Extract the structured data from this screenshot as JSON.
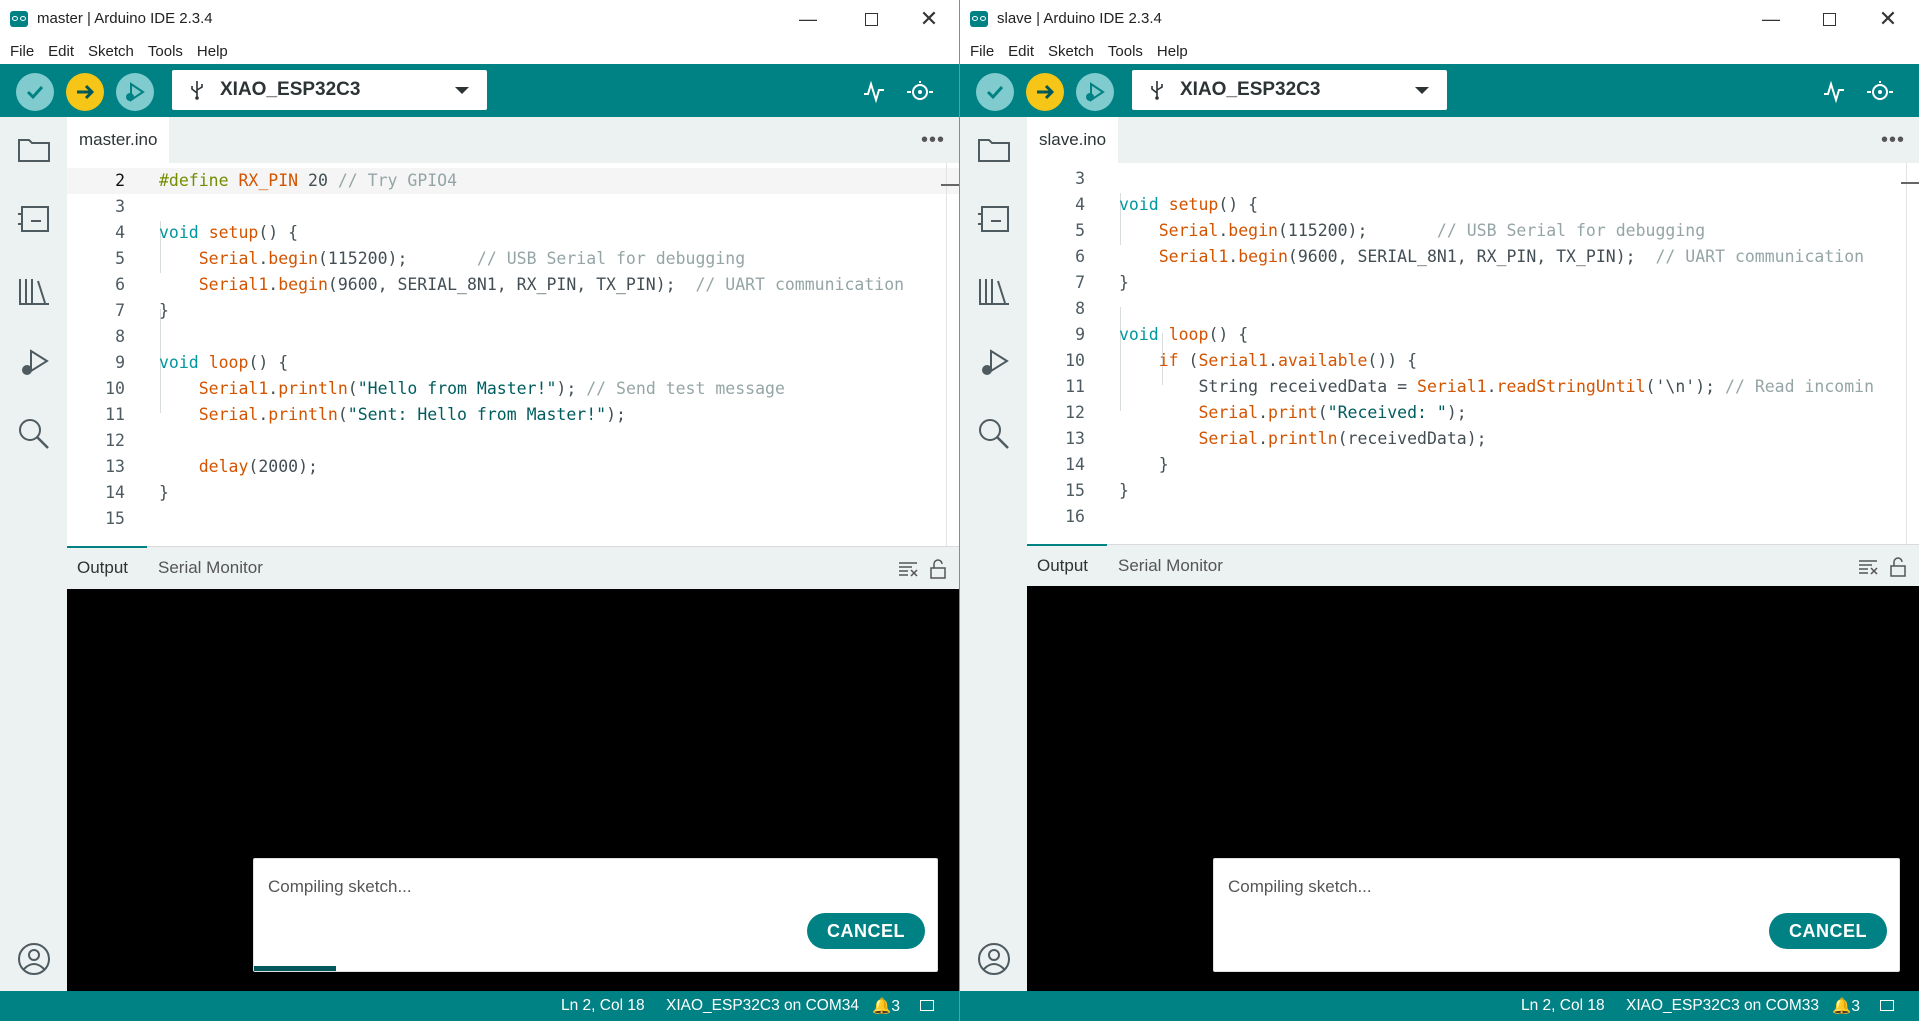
{
  "colors": {
    "teal": "#008184",
    "verify_yellow": "#f39c12",
    "sidebar_bg": "#ecf1f1",
    "output_bg": "#000000"
  },
  "windows": [
    {
      "title": "master | Arduino IDE 2.3.4",
      "menu": [
        "File",
        "Edit",
        "Sketch",
        "Tools",
        "Help"
      ],
      "board": "XIAO_ESP32C3",
      "tab": "master.ino",
      "line_numbers": [
        "2",
        "3",
        "4",
        "5",
        "6",
        "7",
        "8",
        "9",
        "10",
        "11",
        "12",
        "13",
        "14",
        "15"
      ],
      "panel_tabs": [
        "Output",
        "Serial Monitor"
      ],
      "notification": {
        "message": "Compiling sketch...",
        "cancel": "CANCEL",
        "progress_fraction": 0.12
      },
      "status": {
        "position": "Ln 2, Col 18",
        "board_port": "XIAO_ESP32C3 on COM34",
        "notifications": "3"
      }
    },
    {
      "title": "slave | Arduino IDE 2.3.4",
      "menu": [
        "File",
        "Edit",
        "Sketch",
        "Tools",
        "Help"
      ],
      "board": "XIAO_ESP32C3",
      "tab": "slave.ino",
      "line_numbers": [
        "3",
        "4",
        "5",
        "6",
        "7",
        "8",
        "9",
        "10",
        "11",
        "12",
        "13",
        "14",
        "15",
        "16"
      ],
      "panel_tabs": [
        "Output",
        "Serial Monitor"
      ],
      "notification": {
        "message": "Compiling sketch...",
        "cancel": "CANCEL",
        "progress_fraction": 0
      },
      "status": {
        "position": "Ln 2, Col 18",
        "board_port": "XIAO_ESP32C3 on COM33",
        "notifications": "3"
      }
    }
  ],
  "code": {
    "master": {
      "define_kw": "#define",
      "define_name": "RX_PIN",
      "define_val": "20",
      "define_comment": "// Try GPIO4",
      "void1": "void",
      "setup": "setup",
      "paren_open": "() {",
      "serial": "Serial",
      "begin": "begin",
      "baud1": "(115200);",
      "comment_usb": "// USB Serial for debugging",
      "serial1": "Serial1",
      "begin_args": "(9600, SERIAL_8N1, RX_PIN, TX_PIN);",
      "comment_uart": "// UART communication",
      "close_brace": "}",
      "loop": "loop",
      "println": "println",
      "str_hello": "\"Hello from Master!\"",
      "close_stmt": ");",
      "comment_send": "// Send test message",
      "str_sent": "\"Sent: Hello from Master!\"",
      "delay": "delay",
      "delay_arg": "(2000);"
    },
    "slave": {
      "void1": "void",
      "setup": "setup",
      "paren_open": "() {",
      "serial": "Serial",
      "begin": "begin",
      "baud1": "(115200);",
      "comment_usb": "// USB Serial for debugging",
      "serial1": "Serial1",
      "begin_args": "(9600, SERIAL_8N1, RX_PIN, TX_PIN);",
      "comment_uart": "// UART communication",
      "close_brace": "}",
      "loop": "loop",
      "if_kw": "if",
      "available": "available",
      "if_tail": "()) {",
      "string_decl": "String receivedData = ",
      "readStringUntil": "readStringUntil",
      "read_args": "('\\n');",
      "comment_read": "// Read incomin",
      "print": "print",
      "str_received": "\"Received: \"",
      "close_stmt": ");",
      "println": "println",
      "println_arg": "(receivedData);"
    }
  }
}
